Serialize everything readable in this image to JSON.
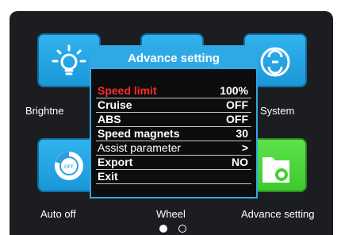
{
  "tiles": [
    {
      "label": "Brightne",
      "icon": "lightbulb-icon"
    },
    {
      "label": "",
      "icon": "settings-icon"
    },
    {
      "label": "System",
      "icon": "system-icon"
    },
    {
      "label": "Auto off",
      "icon": "power-timer-icon"
    },
    {
      "label": "Wheel",
      "icon": "wheel-icon"
    },
    {
      "label": "Advance setting",
      "icon": "folder-gear-icon"
    }
  ],
  "menu": {
    "title": "Advance setting",
    "items": [
      {
        "label": "Speed limit",
        "value": "100%",
        "selected": true
      },
      {
        "label": "Cruise",
        "value": "OFF",
        "selected": false
      },
      {
        "label": "ABS",
        "value": "OFF",
        "selected": false
      },
      {
        "label": "Speed magnets",
        "value": "30",
        "selected": false
      },
      {
        "label": "Assist parameter",
        "value": ">",
        "selected": false
      },
      {
        "label": "Export",
        "value": "NO",
        "selected": false
      },
      {
        "label": "Exit",
        "value": "",
        "selected": false
      }
    ]
  },
  "pager": {
    "current_page": 1,
    "total_pages": 2
  },
  "colors": {
    "tile_blue": "#2fa9e6",
    "tile_green": "#4fd63a",
    "selected_text": "#ff2a2a",
    "background": "#1c1d20"
  }
}
